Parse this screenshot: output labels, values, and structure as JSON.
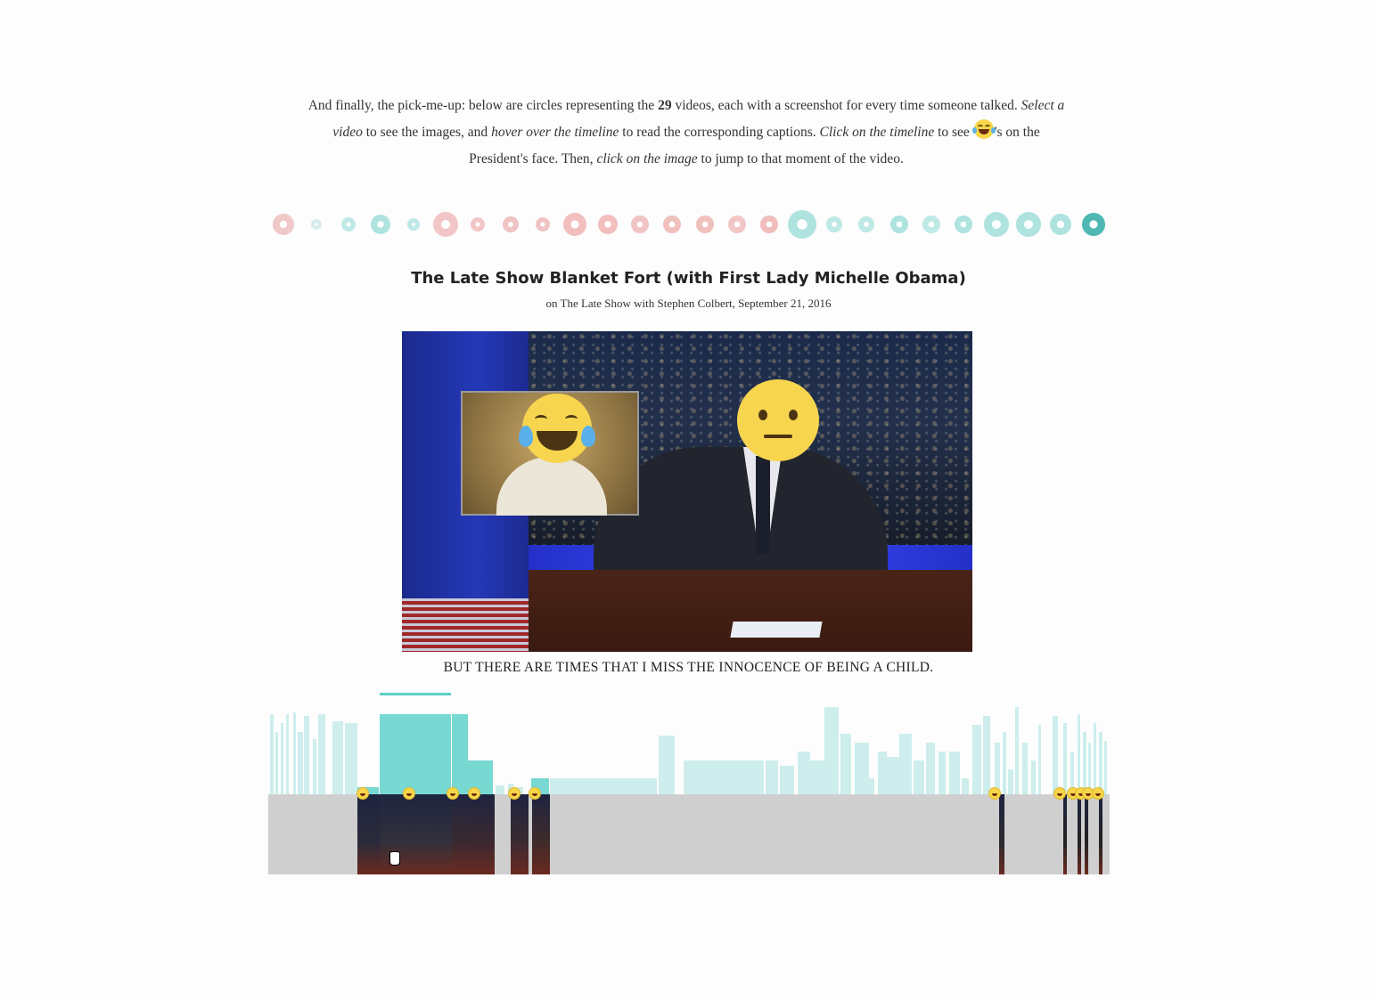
{
  "intro": {
    "p1": "And finally, the pick-me-up: below are circles representing the ",
    "count": "29",
    "p2": " videos, each with a screenshot for every time someone talked. ",
    "select": "Select a video",
    "p3": " to see the images, and ",
    "hover": "hover over the timeline",
    "p4": " to read the corresponding captions. ",
    "click": "Click on the timeline",
    "p5": " to see ",
    "p6": "'s on the President's face. Then, ",
    "clickimg": "click on the image",
    "p7": " to jump to that moment of the video."
  },
  "video": {
    "title": "The Late Show Blanket Fort (with First Lady Michelle Obama)",
    "subtitle": "on The Late Show with Stephen Colbert, September 21, 2016",
    "caption": "BUT THERE ARE TIMES THAT I MISS THE INNOCENCE OF BEING A CHILD."
  },
  "video_circles": [
    {
      "color": "#f0c8c8"
    },
    {
      "color": "#d8ecec"
    },
    {
      "color": "#bfe9e6"
    },
    {
      "color": "#aee3df"
    },
    {
      "color": "#bfe9e6"
    },
    {
      "color": "#f2c6c6"
    },
    {
      "color": "#f2c6c6"
    },
    {
      "color": "#f0c4c4"
    },
    {
      "color": "#f0c4c4"
    },
    {
      "color": "#f2bebe"
    },
    {
      "color": "#f2bebe"
    },
    {
      "color": "#f0c4c4"
    },
    {
      "color": "#f0c0bc"
    },
    {
      "color": "#f0c0bc"
    },
    {
      "color": "#f2c6c6"
    },
    {
      "color": "#f0bcbc"
    },
    {
      "color": "#aee3df"
    },
    {
      "color": "#bfe9e6"
    },
    {
      "color": "#bfe9e6"
    },
    {
      "color": "#aee3df"
    },
    {
      "color": "#bfe9e6"
    },
    {
      "color": "#aee3df"
    },
    {
      "color": "#aee3df"
    },
    {
      "color": "#aee3df"
    },
    {
      "color": "#aee3df"
    },
    {
      "color": "#4fb8b2"
    }
  ],
  "colors": {
    "accent": "#5ccfc8",
    "bar": "#cdeeed",
    "bar_active": "#78d8d2",
    "emoji": "#f7d64a"
  },
  "icons": {
    "laugh": "face-with-tears-of-joy-icon",
    "neutral": "neutral-face-icon"
  }
}
